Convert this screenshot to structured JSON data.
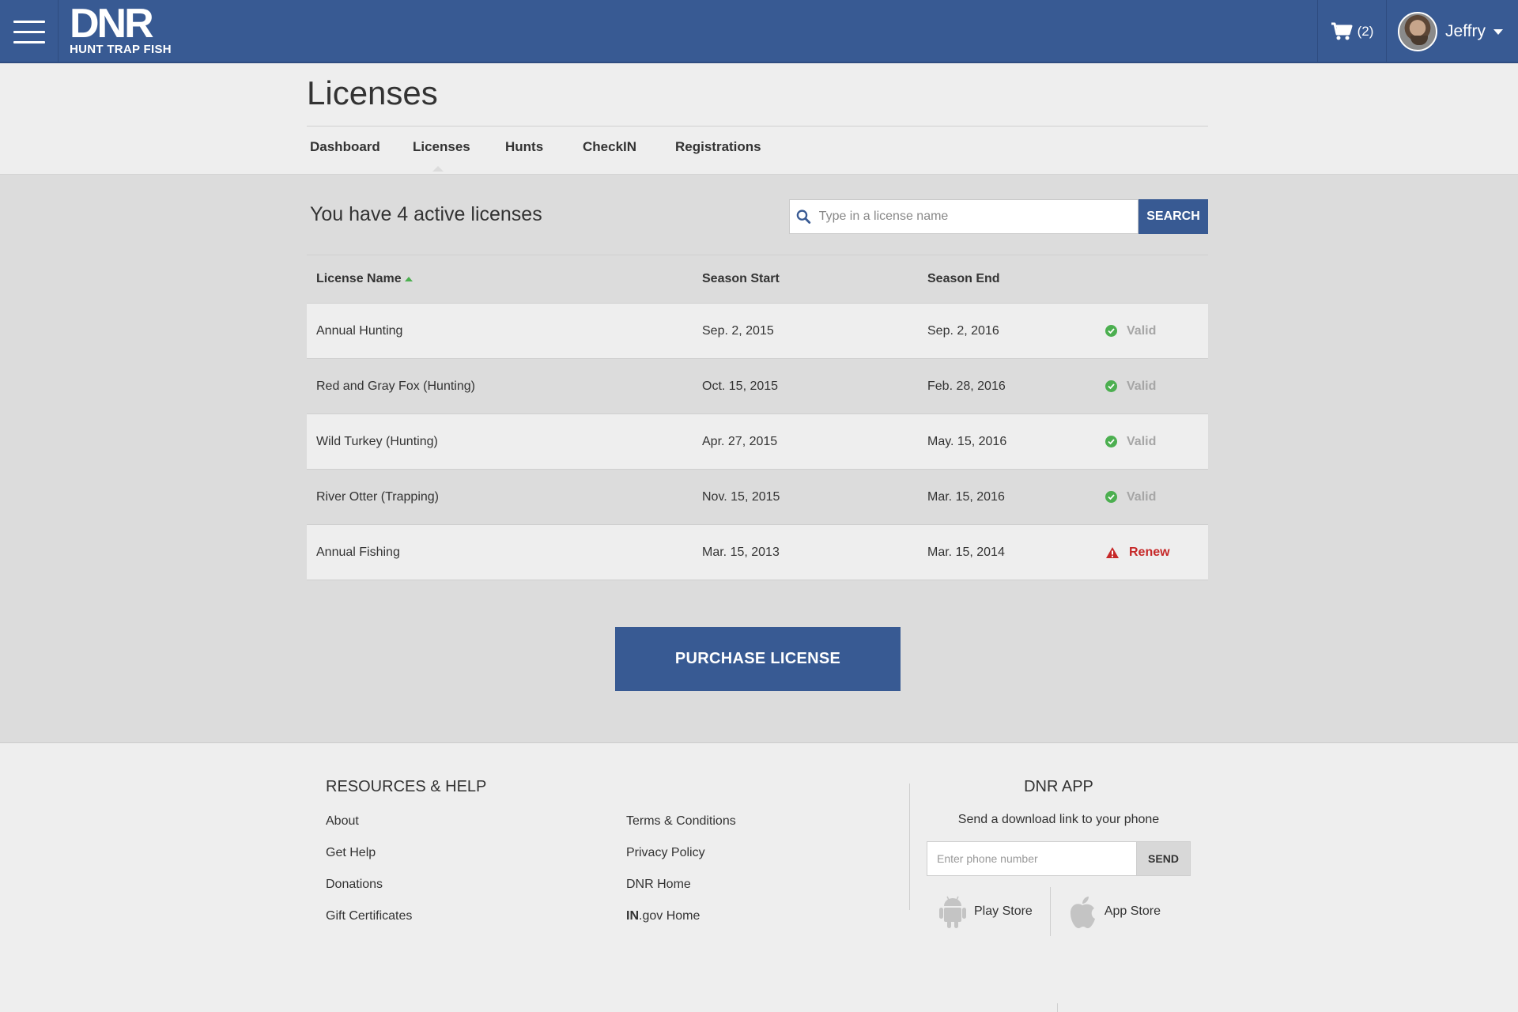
{
  "header": {
    "brand_title": "DNR",
    "brand_tagline": "HUNT TRAP FISH",
    "cart_count": "(2)",
    "user_name": "Jeffry",
    "colors": {
      "bar": "#385a93"
    }
  },
  "page": {
    "title": "Licenses",
    "tabs": [
      {
        "label": "Dashboard"
      },
      {
        "label": "Licenses",
        "active": true
      },
      {
        "label": "Hunts"
      },
      {
        "label": "CheckIN"
      },
      {
        "label": "Registrations"
      }
    ]
  },
  "licenses": {
    "heading": "You have 4 active licenses",
    "search": {
      "placeholder": "Type in a license name",
      "button": "SEARCH"
    },
    "columns": {
      "name": "License Name",
      "start": "Season Start",
      "end": "Season End"
    },
    "sort": {
      "column": "License Name",
      "direction": "ascending"
    },
    "rows": [
      {
        "name": "Annual Hunting",
        "start": "Sep. 2, 2015",
        "end": "Sep. 2, 2016",
        "status": "Valid",
        "status_icon": "check-circle-icon"
      },
      {
        "name": "Red and Gray Fox (Hunting)",
        "start": "Oct. 15, 2015",
        "end": "Feb. 28, 2016",
        "status": "Valid",
        "status_icon": "check-circle-icon"
      },
      {
        "name": "Wild Turkey (Hunting)",
        "start": "Apr. 27, 2015",
        "end": "May. 15, 2016",
        "status": "Valid",
        "status_icon": "check-circle-icon"
      },
      {
        "name": "River Otter (Trapping)",
        "start": "Nov. 15, 2015",
        "end": "Mar. 15, 2016",
        "status": "Valid",
        "status_icon": "check-circle-icon"
      },
      {
        "name": "Annual Fishing",
        "start": "Mar. 15, 2013",
        "end": "Mar. 15, 2014",
        "status": "Renew",
        "status_icon": "warning-icon"
      }
    ],
    "purchase_button": "PURCHASE LICENSE"
  },
  "footer": {
    "resources_title": "RESOURCES & HELP",
    "links_left": [
      "About",
      "Get Help",
      "Donations",
      "Gift Certificates"
    ],
    "links_right": [
      "Terms & Conditions",
      "Privacy Policy",
      "DNR Home"
    ],
    "ingov_bold": "IN",
    "ingov_rest": ".gov Home",
    "app_title": "DNR APP",
    "app_subtitle": "Send a download link to your phone",
    "phone_placeholder": "Enter phone number",
    "send_button": "SEND",
    "play_store": "Play Store",
    "app_store": "App Store"
  }
}
